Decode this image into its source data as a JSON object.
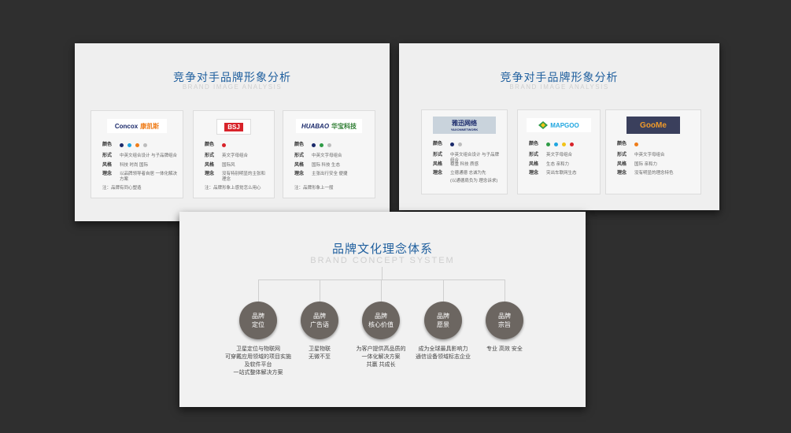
{
  "competitor_panel_1": {
    "title": "竞争对手品牌形象分析",
    "subtitle": "BRAND IMAGE ANALYSIS",
    "cards": [
      {
        "logo_text_a": "Concox",
        "logo_text_b": "康凯斯",
        "color_label": "颜色",
        "colors": [
          "#1b2a6b",
          "#1fa6e0",
          "#ef7d1a",
          "#bdbdbd"
        ],
        "form_label": "形式",
        "form": "中英文组合设计 与子品牌组合",
        "style_label": "风格",
        "style": "科技 时尚 国际",
        "idea_label": "理念",
        "idea": "以品牌领导者自居 一体化解决方案",
        "note": "注：品牌有同心塑造"
      },
      {
        "logo_text_a": "BSJ",
        "logo_text_b": "",
        "color_label": "颜色",
        "colors": [
          "#d8232a"
        ],
        "form_label": "形式",
        "form": "英文字母组合",
        "style_label": "风格",
        "style": "国际风",
        "idea_label": "理念",
        "idea": "没有特别明显的主张和理念",
        "note": "注：品牌形象上感觉怎么用心"
      },
      {
        "logo_text_a": "HUABAO",
        "logo_text_b": "华宝科技",
        "color_label": "颜色",
        "colors": [
          "#1b2a6b",
          "#2e9b46",
          "#bdbdbd"
        ],
        "form_label": "形式",
        "form": "中英文字母组合",
        "style_label": "风格",
        "style": "国际 科技 生态",
        "idea_label": "理念",
        "idea": "主张出行安全 便捷",
        "note": "注：品牌形象上一般"
      }
    ]
  },
  "competitor_panel_2": {
    "title": "竞争对手品牌形象分析",
    "subtitle": "BRAND IMAGE ANALYSIS",
    "cards": [
      {
        "logo_text_a": "雅迅网络",
        "logo_text_b": "YAXONNETWORK",
        "color_label": "颜色",
        "colors": [
          "#1b2a6b",
          "#bdbdbd"
        ],
        "form_label": "形式",
        "form": "中英文组合设计 与子品牌组合",
        "style_label": "风格",
        "style": "稳重 科技 质感",
        "idea_label": "理念",
        "idea": "立德通德 志诚为先",
        "idea2": "(以通德肩负为 理念诉求)"
      },
      {
        "logo_text_a": "MAPGOO",
        "logo_text_b": "",
        "color_label": "颜色",
        "colors": [
          "#2e9b46",
          "#1fa6e0",
          "#f2c318",
          "#d8232a"
        ],
        "form_label": "形式",
        "form": "英文字母组合",
        "style_label": "风格",
        "style": "生态 亲和力",
        "idea_label": "理念",
        "idea": "突出车联网生态"
      },
      {
        "logo_text_a": "GooMe",
        "logo_text_b": "",
        "color_label": "颜色",
        "colors": [
          "#ef7d1a"
        ],
        "form_label": "形式",
        "form": "中英文字母组合",
        "style_label": "风格",
        "style": "国际 亲和力",
        "idea_label": "理念",
        "idea": "没有明显的理念特色"
      }
    ]
  },
  "concept_panel": {
    "title": "品牌文化理念体系",
    "subtitle": "BRAND CONCEPT SYSTEM",
    "nodes": [
      {
        "line1": "品牌",
        "line2": "定位",
        "desc": [
          "卫星定位与物联网",
          "可穿戴应用领域的项目实施",
          "及软件平台",
          "一站式整体解决方案"
        ]
      },
      {
        "line1": "品牌",
        "line2": "广告语",
        "desc": [
          "卫星物联",
          "无微不至"
        ]
      },
      {
        "line1": "品牌",
        "line2": "核心价值",
        "desc": [
          "为客户提供高品质的",
          "一体化解决方案",
          "共赢 共成长"
        ]
      },
      {
        "line1": "品牌",
        "line2": "愿景",
        "desc": [
          "成为全球最具影响力",
          "通信设备领域标志企业"
        ]
      },
      {
        "line1": "品牌",
        "line2": "宗旨",
        "desc": [
          "专业 高效 安全"
        ]
      }
    ]
  }
}
